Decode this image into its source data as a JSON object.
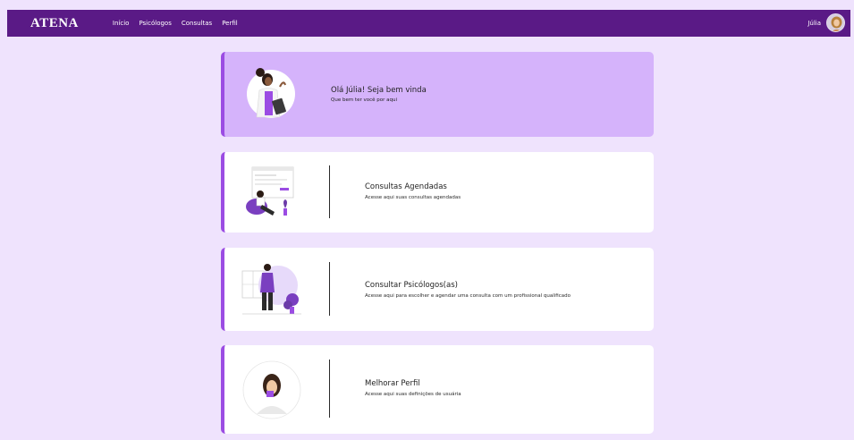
{
  "navbar": {
    "brand": "ATENA",
    "links": [
      "Início",
      "Psicólogos",
      "Consultas",
      "Perfil"
    ],
    "user_name": "Júlia"
  },
  "welcome": {
    "title": "Olá Júlia! Seja bem vinda",
    "subtitle": "Que bem ter você por aqui"
  },
  "cards": [
    {
      "title": "Consultas Agendadas",
      "subtitle": "Acesse aqui suas consultas agendadas"
    },
    {
      "title": "Consultar Psicólogos(as)",
      "subtitle": "Acesse aqui para escolher e agendar uma consulta com um profissional qualificado"
    },
    {
      "title": "Melhorar Perfil",
      "subtitle": "Acesse aqui suas definições de usuária"
    }
  ],
  "colors": {
    "navbar": "#5a1a86",
    "background": "#efe3fd",
    "welcome_card": "#d5b3fb",
    "accent": "#9b4ce3"
  }
}
